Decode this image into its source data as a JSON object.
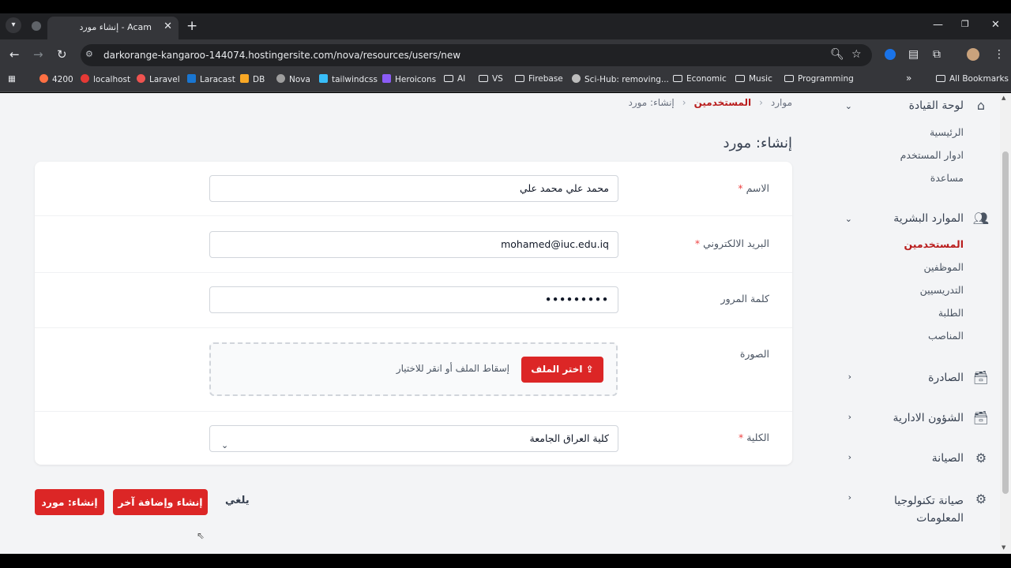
{
  "browser": {
    "tab_title": "إنشاء مورد - Acam",
    "url": "darkorange-kangaroo-144074.hostingersite.com/nova/resources/users/new",
    "bookmarks": [
      "4200",
      "localhost",
      "Laravel",
      "Laracast",
      "DB",
      "Nova",
      "tailwindcss",
      "Heroicons",
      "AI",
      "VS",
      "Firebase",
      "Sci-Hub: removing...",
      "Economic",
      "Music",
      "Programming"
    ],
    "all_bookmarks": "All Bookmarks",
    "overflow": "»"
  },
  "sidebar": {
    "dashboard": {
      "title": "لوحة القيادة",
      "items": [
        "الرئيسية",
        "ادوار المستخدم",
        "مساعدة"
      ]
    },
    "hr": {
      "title": "الموارد البشرية",
      "items": [
        "المستخدمين",
        "الموظفين",
        "التدريسيين",
        "الطلبة",
        "المناصب"
      ],
      "active": "المستخدمين"
    },
    "outgoing": {
      "title": "الصادرة"
    },
    "admin": {
      "title": "الشؤون الادارية"
    },
    "maintenance": {
      "title": "الصيانة"
    },
    "it": {
      "title": "صيانة تكنولوجيا المعلومات"
    }
  },
  "breadcrumb": {
    "root": "موارد",
    "section": "المستخدمين",
    "current": "إنشاء: مورد"
  },
  "page_title": "إنشاء: مورد",
  "form": {
    "name": {
      "label": "الاسم",
      "value": "محمد علي محمد علي"
    },
    "email": {
      "label": "البريد الالكتروني",
      "value": "mohamed@iuc.edu.iq"
    },
    "password": {
      "label": "كلمة المرور",
      "value": "•••••••••"
    },
    "image": {
      "label": "الصورة",
      "button": "اختر الملف",
      "hint": "إسقاط الملف أو انقر للاختيار"
    },
    "college": {
      "label": "الكلية",
      "value": "كلية العراق الجامعة"
    },
    "required_mark": "*"
  },
  "actions": {
    "create": "إنشاء: مورد",
    "create_another": "إنشاء وإضافة آخر",
    "cancel": "يلغي"
  }
}
